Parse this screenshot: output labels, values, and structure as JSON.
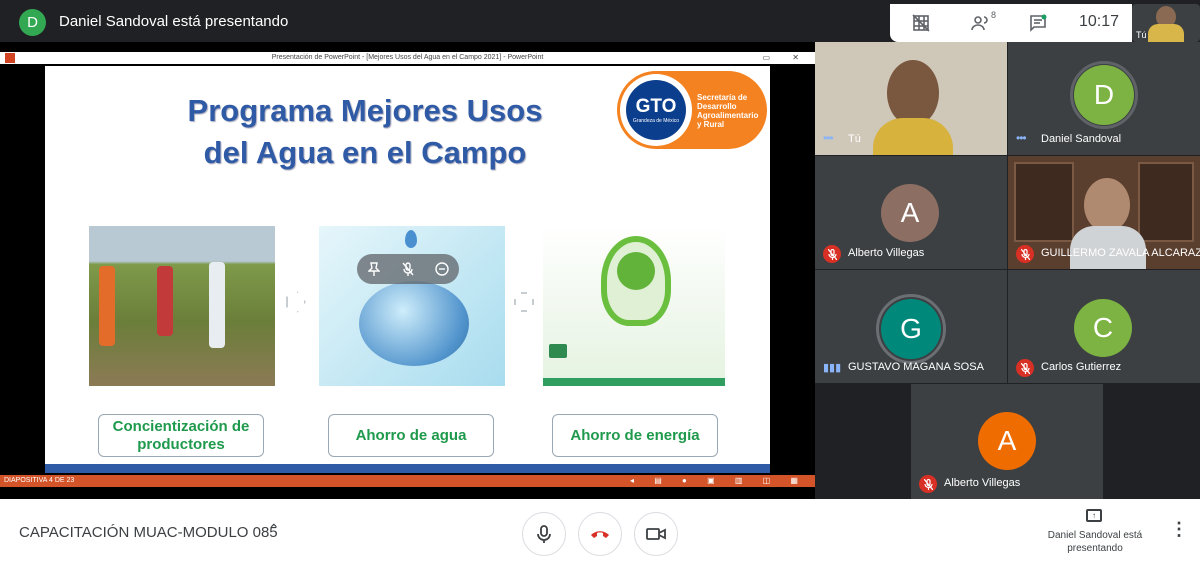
{
  "header": {
    "presenter_initial": "D",
    "presenter_text": "Daniel Sandoval está presentando",
    "participant_count": "8",
    "clock": "10:17",
    "self_label": "Tú",
    "icons": [
      "grid-layout-icon",
      "people-icon",
      "chat-icon"
    ]
  },
  "presentation": {
    "window_title": "Presentación de PowerPoint - [Mejores Usos del Agua en el Campo 2021] - PowerPoint",
    "window_buttons": "▭ ✕",
    "slide_title_line1": "Programa Mejores Usos",
    "slide_title_line2": "del Agua en el Campo",
    "logo_gto": "GTO",
    "logo_tagline": "Grandeza de México",
    "logo_text": "Secretaría de Desarrollo Agroalimentario y Rural",
    "labels": {
      "concientizacion": "Concientización de productores",
      "ahorro_agua": "Ahorro de agua",
      "ahorro_energia": "Ahorro  de energía"
    },
    "status_text": "DIAPOSITIVA 4 DE 23",
    "status_icons": "◂ ▤ ● ▣ ▥ ◫ ▦"
  },
  "participants": [
    {
      "name": "Tú",
      "type": "video",
      "speaking": true
    },
    {
      "name": "Daniel Sandoval",
      "initial": "D",
      "color": "#7cb342"
    },
    {
      "name": "Alberto Villegas",
      "initial": "A",
      "color": "#8d6e63",
      "muted": true
    },
    {
      "name": "GUILLERMO ZAVALA ALCARAZ",
      "type": "video",
      "muted": true
    },
    {
      "name": "GUSTAVO MAGANA SOSA",
      "initial": "G",
      "color": "#00897b",
      "speaking": true
    },
    {
      "name": "Carlos Gutierrez",
      "initial": "C",
      "color": "#7cb342",
      "muted": true
    },
    {
      "name": "Alberto Villegas",
      "initial": "A",
      "color": "#ef6c00",
      "muted": true
    }
  ],
  "footer": {
    "meeting_name": "CAPACITACIÓN MUAC-MODULO 085",
    "chevron": "⌃",
    "presenting_text": "Daniel Sandoval está presentando",
    "more": "⋮"
  },
  "colors": {
    "accent_green": "#1f9a4d",
    "slide_blue": "#2e5aa6",
    "hangup_red": "#d93025",
    "ppt_orange": "#d35428"
  }
}
